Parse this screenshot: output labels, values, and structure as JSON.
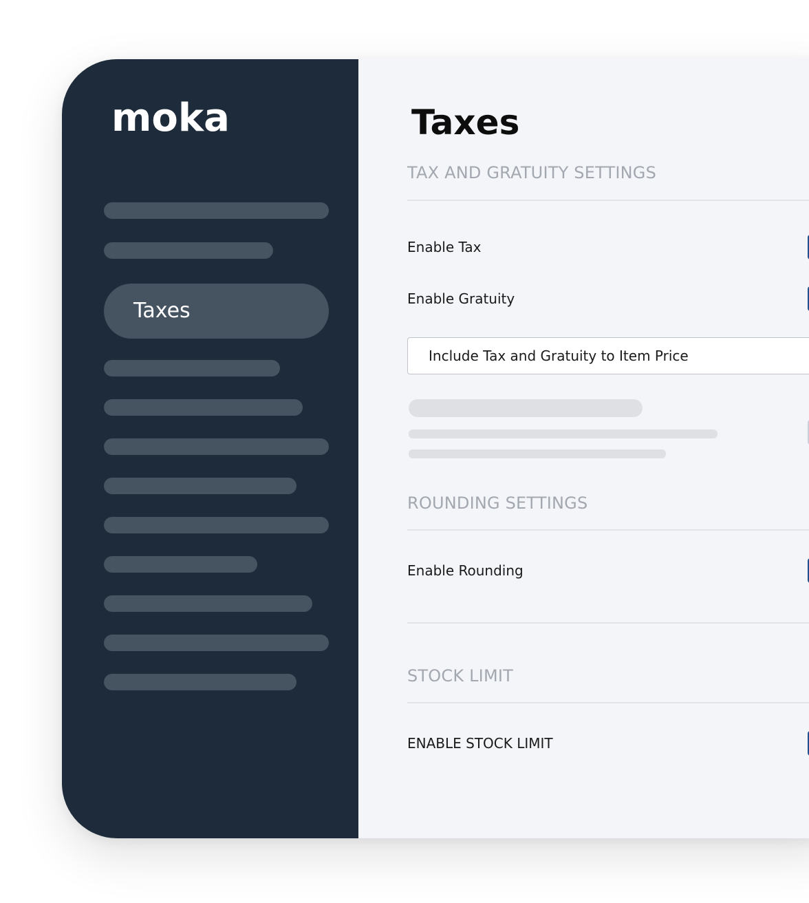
{
  "sidebar": {
    "logo": "moka",
    "active_item": "Taxes"
  },
  "main": {
    "title": "Taxes",
    "sections": [
      {
        "heading": "TAX AND GRATUITY SETTINGS",
        "rows": [
          {
            "label": "Enable Tax"
          },
          {
            "label": "Enable Gratuity"
          }
        ],
        "select_value": "Include Tax and Gratuity to Item Price"
      },
      {
        "heading": "ROUNDING SETTINGS",
        "rows": [
          {
            "label": "Enable Rounding"
          }
        ]
      },
      {
        "heading": "STOCK LIMIT",
        "rows": [
          {
            "label": "ENABLE STOCK LIMIT"
          }
        ]
      }
    ]
  },
  "colors": {
    "sidebar_bg": "#1e2b3a",
    "sidebar_item_bg": "#465361",
    "content_bg": "#f4f5f9",
    "toggle_accent": "#1f4f8f"
  }
}
